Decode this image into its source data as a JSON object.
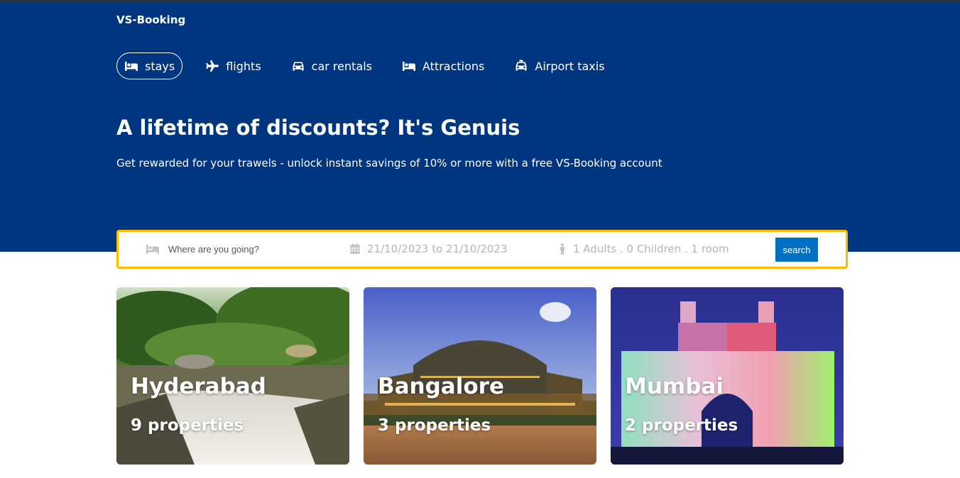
{
  "app": {
    "brand": "VS-Booking"
  },
  "nav": {
    "items": [
      {
        "label": "stays",
        "icon": "bed-icon",
        "active": true
      },
      {
        "label": "flights",
        "icon": "plane-icon",
        "active": false
      },
      {
        "label": "car rentals",
        "icon": "car-icon",
        "active": false
      },
      {
        "label": "Attractions",
        "icon": "bed-icon",
        "active": false
      },
      {
        "label": "Airport taxis",
        "icon": "taxi-icon",
        "active": false
      }
    ]
  },
  "hero": {
    "title": "A lifetime of discounts? It's Genuis",
    "subtitle": "Get rewarded for your trawels - unlock instant savings of 10% or more with a free VS-Booking account"
  },
  "search": {
    "destination_placeholder": "Where are you going?",
    "destination_value": "",
    "date_range": "21/10/2023 to 21/10/2023",
    "guests": "1 Adults . 0 Children . 1 room",
    "button_label": "search"
  },
  "featured": [
    {
      "city": "Hyderabad",
      "properties": "9 properties"
    },
    {
      "city": "Bangalore",
      "properties": "3 properties"
    },
    {
      "city": "Mumbai",
      "properties": "2 properties"
    }
  ],
  "colors": {
    "hero_bg": "#003580",
    "search_border": "#febb02",
    "button_bg": "#0071c2"
  }
}
